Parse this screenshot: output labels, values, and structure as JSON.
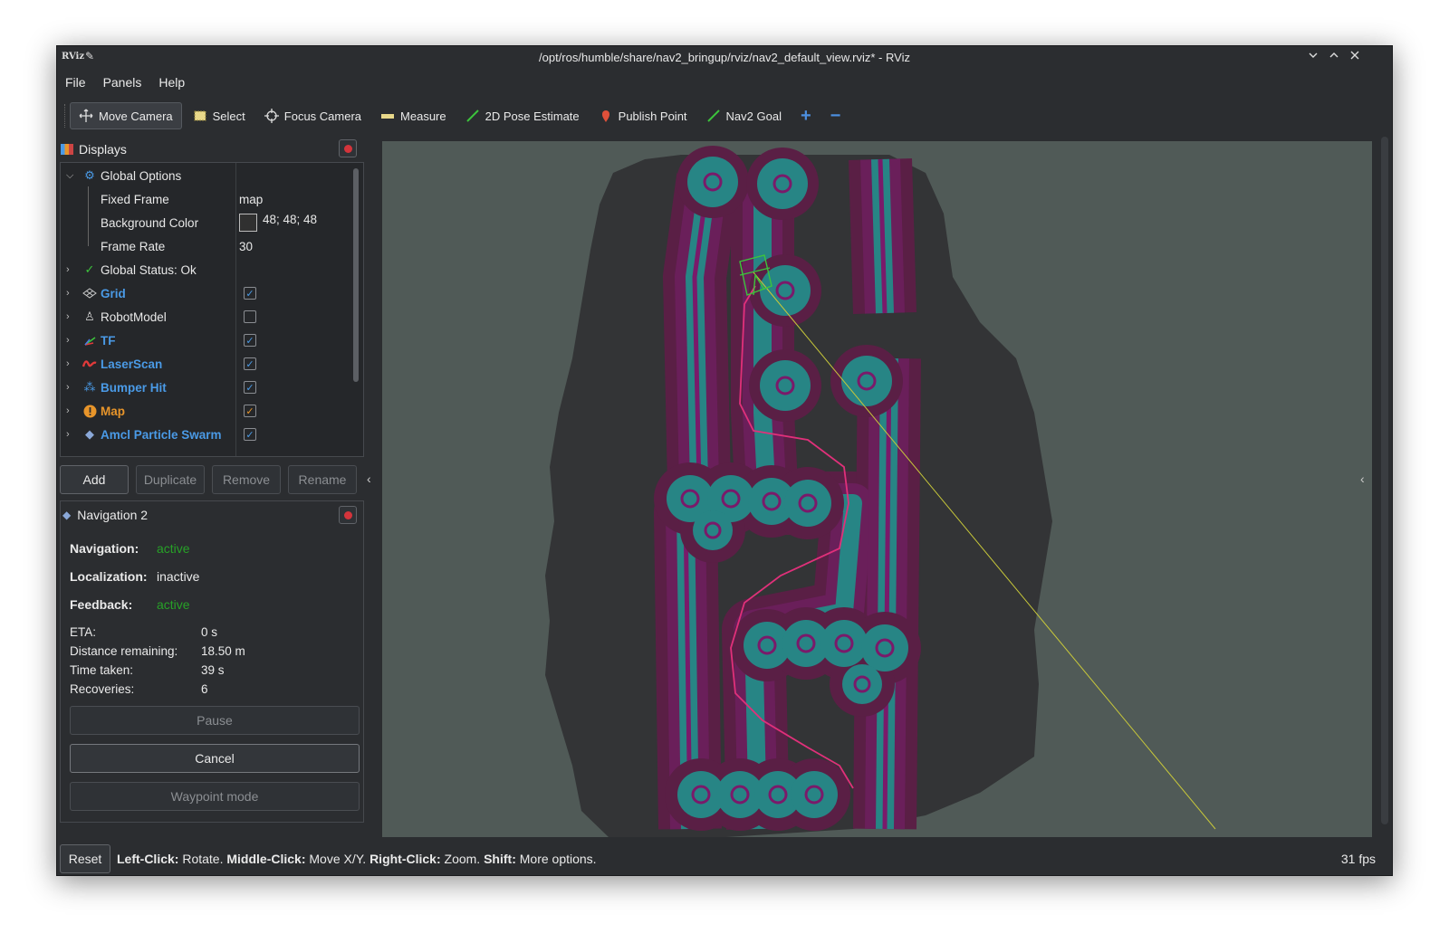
{
  "window": {
    "logo": "RViz",
    "title": "/opt/ros/humble/share/nav2_bringup/rviz/nav2_default_view.rviz* - RViz"
  },
  "menu": [
    "File",
    "Panels",
    "Help"
  ],
  "toolbar": {
    "move_camera": "Move Camera",
    "select": "Select",
    "focus_camera": "Focus Camera",
    "measure": "Measure",
    "pose_estimate": "2D Pose Estimate",
    "publish_point": "Publish Point",
    "nav2_goal": "Nav2 Goal",
    "add_tool": "+",
    "remove_tool": "−"
  },
  "displays": {
    "title": "Displays",
    "global_options": "Global Options",
    "fixed_frame_label": "Fixed Frame",
    "fixed_frame_value": "map",
    "background_color_label": "Background Color",
    "background_color_value": "48; 48; 48",
    "frame_rate_label": "Frame Rate",
    "frame_rate_value": "30",
    "global_status": "Global Status: Ok",
    "items": [
      {
        "label": "Grid",
        "checked": true
      },
      {
        "label": "RobotModel",
        "checked": false
      },
      {
        "label": "TF",
        "checked": true
      },
      {
        "label": "LaserScan",
        "checked": true
      },
      {
        "label": "Bumper Hit",
        "checked": true
      },
      {
        "label": "Map",
        "checked": true
      },
      {
        "label": "Amcl Particle Swarm",
        "checked": true
      }
    ],
    "buttons": {
      "add": "Add",
      "duplicate": "Duplicate",
      "remove": "Remove",
      "rename": "Rename"
    }
  },
  "navigation": {
    "title": "Navigation 2",
    "navigation_label": "Navigation:",
    "navigation_value": "active",
    "localization_label": "Localization:",
    "localization_value": "inactive",
    "feedback_label": "Feedback:",
    "feedback_value": "active",
    "eta_label": "ETA:",
    "eta_value": "0 s",
    "distance_label": "Distance remaining:",
    "distance_value": "18.50 m",
    "time_label": "Time taken:",
    "time_value": "39 s",
    "recoveries_label": "Recoveries:",
    "recoveries_value": "6",
    "pause": "Pause",
    "cancel": "Cancel",
    "waypoint": "Waypoint mode"
  },
  "status": {
    "reset": "Reset",
    "hint_lc": "Left-Click:",
    "hint_lc_txt": " Rotate. ",
    "hint_mc": "Middle-Click:",
    "hint_mc_txt": " Move X/Y. ",
    "hint_rc": "Right-Click:",
    "hint_rc_txt": " Zoom. ",
    "hint_sh": "Shift:",
    "hint_sh_txt": " More options.",
    "fps": "31 fps"
  },
  "colors": {
    "accent": "#4a9ae6",
    "map_orange": "#e8952a",
    "active_green": "#27a127",
    "costmap_teal": "#2a8a8a",
    "costmap_magenta": "#7a1a6a",
    "path_pink": "#e0307a"
  }
}
